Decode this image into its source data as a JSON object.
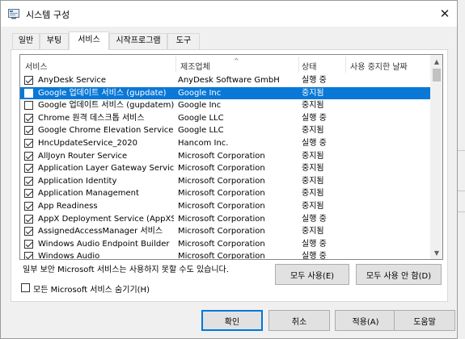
{
  "window": {
    "title": "시스템 구성"
  },
  "tabs": [
    {
      "label": "일반"
    },
    {
      "label": "부팅"
    },
    {
      "label": "서비스"
    },
    {
      "label": "시작프로그램"
    },
    {
      "label": "도구"
    }
  ],
  "list": {
    "columns": {
      "name": "서비스",
      "manufacturer": "제조업체",
      "status": "상태",
      "disabled_date": "사용 중지한 날짜"
    },
    "rows": [
      {
        "name": "AnyDesk Service",
        "manufacturer": "AnyDesk Software GmbH",
        "status": "실행 중",
        "checked": true
      },
      {
        "name": "Google 업데이트 서비스 (gupdate)",
        "manufacturer": "Google Inc",
        "status": "중지됨",
        "checked": false,
        "selected": true
      },
      {
        "name": "Google 업데이트 서비스 (gupdatem)",
        "manufacturer": "Google Inc",
        "status": "중지됨",
        "checked": false
      },
      {
        "name": "Chrome 원격 데스크톱 서비스",
        "manufacturer": "Google LLC",
        "status": "실행 중",
        "checked": true
      },
      {
        "name": "Google Chrome Elevation Service (...",
        "manufacturer": "Google LLC",
        "status": "중지됨",
        "checked": true
      },
      {
        "name": "HncUpdateService_2020",
        "manufacturer": "Hancom Inc.",
        "status": "실행 중",
        "checked": true
      },
      {
        "name": "AllJoyn Router Service",
        "manufacturer": "Microsoft Corporation",
        "status": "중지됨",
        "checked": true
      },
      {
        "name": "Application Layer Gateway Service",
        "manufacturer": "Microsoft Corporation",
        "status": "중지됨",
        "checked": true
      },
      {
        "name": "Application Identity",
        "manufacturer": "Microsoft Corporation",
        "status": "중지됨",
        "checked": true
      },
      {
        "name": "Application Management",
        "manufacturer": "Microsoft Corporation",
        "status": "중지됨",
        "checked": true
      },
      {
        "name": "App Readiness",
        "manufacturer": "Microsoft Corporation",
        "status": "중지됨",
        "checked": true
      },
      {
        "name": "AppX Deployment Service (AppXSV...",
        "manufacturer": "Microsoft Corporation",
        "status": "실행 중",
        "checked": true
      },
      {
        "name": "AssignedAccessManager 서비스",
        "manufacturer": "Microsoft Corporation",
        "status": "중지됨",
        "checked": true
      },
      {
        "name": "Windows Audio Endpoint Builder",
        "manufacturer": "Microsoft Corporation",
        "status": "실행 중",
        "checked": true
      },
      {
        "name": "Windows Audio",
        "manufacturer": "Microsoft Corporation",
        "status": "실행 중",
        "checked": true
      }
    ]
  },
  "note": "일부 보안 Microsoft 서비스는 사용하지 못할 수도 있습니다.",
  "buttons": {
    "enable_all": "모두 사용(E)",
    "disable_all": "모두 사용 안 함(D)",
    "ok": "확인",
    "cancel": "취소",
    "apply": "적용(A)",
    "help": "도움말"
  },
  "hide_ms_services": {
    "label": "모든 Microsoft 서비스 숨기기(H)",
    "checked": false
  },
  "colors": {
    "selection": "#0a78d7",
    "primary_border": "#0078d7"
  }
}
